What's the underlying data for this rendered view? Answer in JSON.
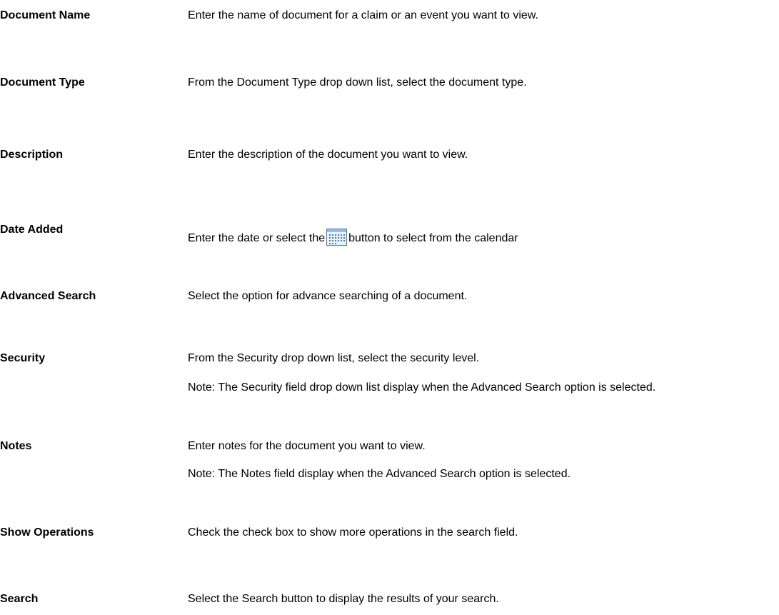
{
  "fields": [
    {
      "name": "Document Name",
      "description": "Enter the name of document for a claim or an event you want to view."
    },
    {
      "name": "Document Type",
      "description": "From the Document Type drop down list, select the document type."
    },
    {
      "name": "Description",
      "description": "Enter the description of the document you want to view."
    },
    {
      "name": "Date Added",
      "description_before": "Enter the date or select the",
      "description_after": "button to select from the calendar",
      "icon": "calendar-icon"
    },
    {
      "name": "Advanced Search",
      "description": "Select the option for advance searching of a document."
    },
    {
      "name": "Security",
      "description": "From the Security drop down list, select the security level.",
      "note": "Note: The Security field drop down list display when the Advanced Search option is selected."
    },
    {
      "name": "Notes",
      "description": "Enter notes for the document you want to view.",
      "note": "Note: The Notes field display when the Advanced Search option is selected."
    },
    {
      "name": "Show Operations",
      "description": "Check the check box to show more operations in the search field."
    },
    {
      "name": "Search",
      "description": "Select the Search button to display the results of your search."
    }
  ],
  "colors": {
    "text": "#000000",
    "background": "#ffffff",
    "icon_border": "#4a7ab8",
    "icon_fill": "#eaf1fb",
    "icon_header": "#9bbbe3"
  }
}
